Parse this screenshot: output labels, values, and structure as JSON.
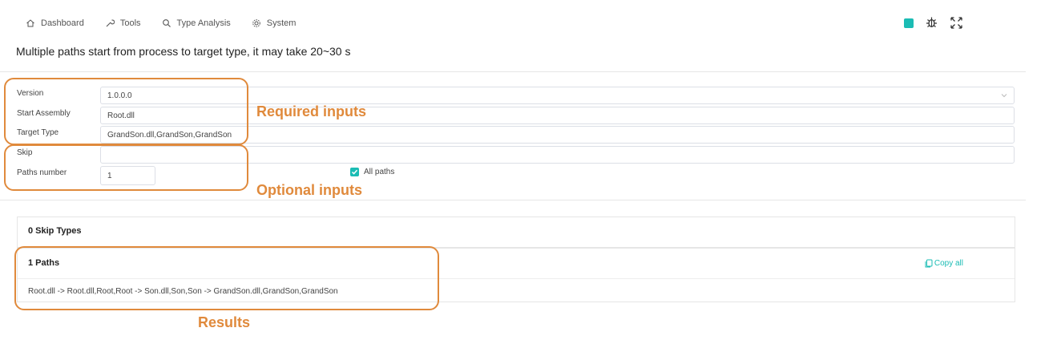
{
  "nav": {
    "items": [
      {
        "label": "Dashboard",
        "icon": "home-icon"
      },
      {
        "label": "Tools",
        "icon": "wrench-icon"
      },
      {
        "label": "Type Analysis",
        "icon": "search-icon"
      },
      {
        "label": "System",
        "icon": "gear-icon"
      }
    ],
    "right_icons": [
      "theme-color-icon",
      "bug-icon",
      "fullscreen-icon"
    ]
  },
  "page": {
    "title": "Multiple paths start from process to target type, it may take 20~30 s"
  },
  "form": {
    "version": {
      "label": "Version",
      "value": "1.0.0.0"
    },
    "start_assembly": {
      "label": "Start Assembly",
      "value": "Root.dll"
    },
    "target_type": {
      "label": "Target Type",
      "value": "GrandSon.dll,GrandSon,GrandSon"
    },
    "skip": {
      "label": "Skip",
      "value": ""
    },
    "paths_number": {
      "label": "Paths number",
      "value": "1"
    },
    "all_paths": {
      "label": "All paths",
      "checked": true
    }
  },
  "results": {
    "skip_types_title": "0 Skip Types",
    "paths_title": "1 Paths",
    "copy_all": "Copy all",
    "path_line": "Root.dll -> Root.dll,Root,Root -> Son.dll,Son,Son -> GrandSon.dll,GrandSon,GrandSon"
  },
  "annotations": {
    "required": "Required inputs",
    "optional": "Optional inputs",
    "results": "Results"
  },
  "colors": {
    "accent": "#1bbcb4",
    "annotation": "#e08a3c"
  }
}
